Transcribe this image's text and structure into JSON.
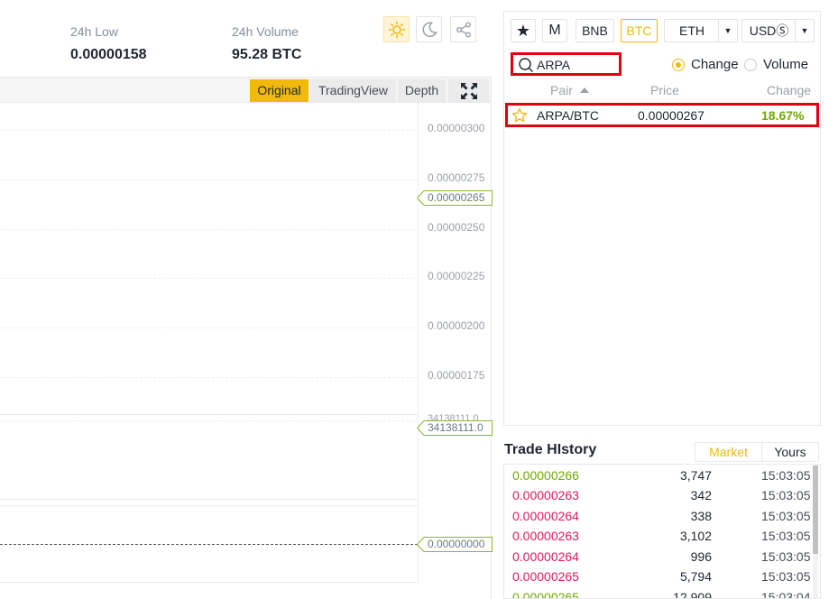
{
  "stats": {
    "low_label": "24h Low",
    "low_value": "0.00000158",
    "volume_label": "24h Volume",
    "volume_value": "95.28 BTC"
  },
  "chart": {
    "tabs": [
      "Original",
      "TradingView",
      "Depth"
    ],
    "active_tab": "Original",
    "axis_labels": [
      "0.00000300",
      "0.00000275",
      "0.00000250",
      "0.00000225",
      "0.00000200",
      "0.00000175"
    ],
    "current_price_tag": "0.00000265",
    "volume_axis_top": "34138111.0",
    "volume_tag": "34138111.0",
    "indicator_tag": "0.00000000"
  },
  "market": {
    "quote_tabs": [
      "BNB",
      "BTC",
      "ETH"
    ],
    "active_quote": "BTC",
    "fiat_label": "USDⓈ",
    "favorites_glyph": "★",
    "margin_label": "M",
    "search_value": "ARPA",
    "sort_options": [
      "Change",
      "Volume"
    ],
    "sort_selected": "Change",
    "columns": {
      "pair": "Pair",
      "price": "Price",
      "change": "Change"
    },
    "rows": [
      {
        "pair": "ARPA/BTC",
        "price": "0.00000267",
        "change": "18.67%"
      }
    ]
  },
  "trade_history": {
    "title": "Trade HIstory",
    "tabs": [
      "Market",
      "Yours"
    ],
    "active_tab": "Market",
    "rows": [
      {
        "price": "0.00000266",
        "amount": "3,747",
        "time": "15:03:05",
        "side": "buy"
      },
      {
        "price": "0.00000263",
        "amount": "342",
        "time": "15:03:05",
        "side": "sell"
      },
      {
        "price": "0.00000264",
        "amount": "338",
        "time": "15:03:05",
        "side": "sell"
      },
      {
        "price": "0.00000263",
        "amount": "3,102",
        "time": "15:03:05",
        "side": "sell"
      },
      {
        "price": "0.00000264",
        "amount": "996",
        "time": "15:03:05",
        "side": "sell"
      },
      {
        "price": "0.00000265",
        "amount": "5,794",
        "time": "15:03:05",
        "side": "sell"
      },
      {
        "price": "0.00000265",
        "amount": "12,909",
        "time": "15:03:04",
        "side": "buy"
      }
    ]
  },
  "colors": {
    "accent": "#f0b90b",
    "buy": "#70a800",
    "sell": "#e0195a",
    "highlight_box": "#e2000f"
  }
}
